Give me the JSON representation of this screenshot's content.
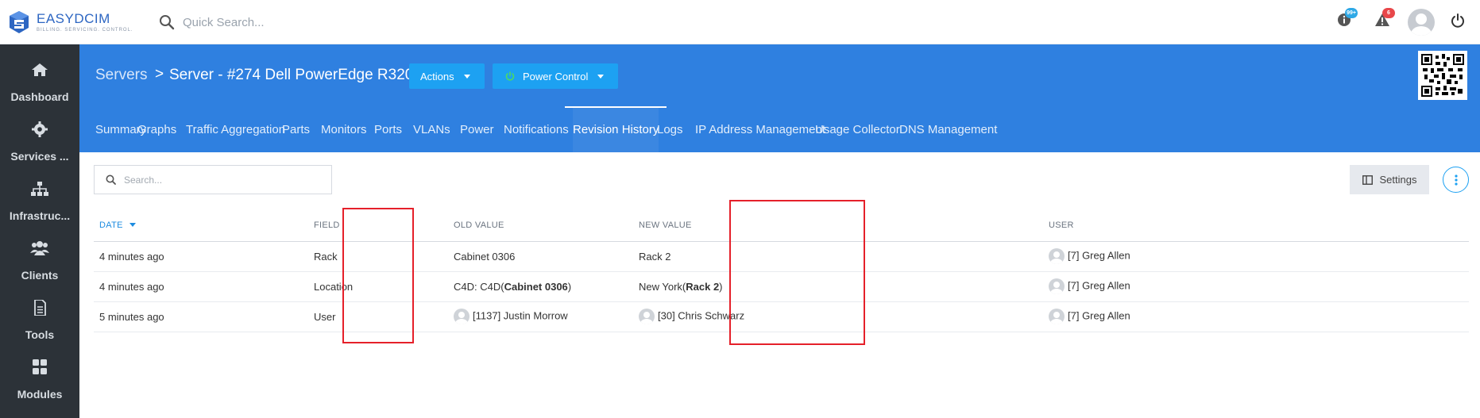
{
  "brand": {
    "name": "EASYDCIM",
    "tagline": "BILLING. SERVICING. CONTROL."
  },
  "topbar": {
    "search_placeholder": "Quick Search...",
    "info_badge": "99+",
    "alert_badge": "6"
  },
  "sidebar": {
    "items": [
      {
        "label": "Dashboard",
        "icon": "home-icon"
      },
      {
        "label": "Services ...",
        "icon": "gear-icon"
      },
      {
        "label": "Infrastruc...",
        "icon": "sitemap-icon"
      },
      {
        "label": "Clients",
        "icon": "users-icon"
      },
      {
        "label": "Tools",
        "icon": "document-icon"
      },
      {
        "label": "Modules",
        "icon": "grid-icon"
      }
    ]
  },
  "header": {
    "breadcrumb": "Servers",
    "separator": ">",
    "title": "Server - #274 Dell PowerEdge R320",
    "actions_label": "Actions",
    "power_label": "Power Control"
  },
  "tabs": [
    "Summary",
    "Graphs",
    "Traffic Aggregation",
    "Parts",
    "Monitors",
    "Ports",
    "VLANs",
    "Power",
    "Notifications",
    "Revision History",
    "Logs",
    "IP Address Management",
    "Usage Collector",
    "DNS Management"
  ],
  "active_tab": "Revision History",
  "content": {
    "search_placeholder": "Search...",
    "settings_label": "Settings"
  },
  "table": {
    "columns": [
      "DATE",
      "FIELD",
      "OLD VALUE",
      "NEW VALUE",
      "USER"
    ],
    "rows": [
      {
        "date": "4 minutes ago",
        "field": "Rack",
        "old_plain": "Cabinet 0306",
        "new_plain": "Rack 2",
        "user": "[7] Greg Allen"
      },
      {
        "date": "4 minutes ago",
        "field": "Location",
        "old_prefix": "C4D: C4D(",
        "old_bold": "Cabinet 0306",
        "old_suffix": ")",
        "new_prefix": "New York(",
        "new_bold": "Rack 2",
        "new_suffix": ")",
        "user": "[7] Greg Allen"
      },
      {
        "date": "5 minutes ago",
        "field": "User",
        "old_user": "[1137] Justin Morrow",
        "new_user": "[30] Chris Schwarz",
        "user": "[7] Greg Allen"
      }
    ]
  },
  "colors": {
    "header": "#2f80e0",
    "sidebar": "#2c3238",
    "accent": "#1da1f2",
    "highlight": "#e5202a"
  }
}
